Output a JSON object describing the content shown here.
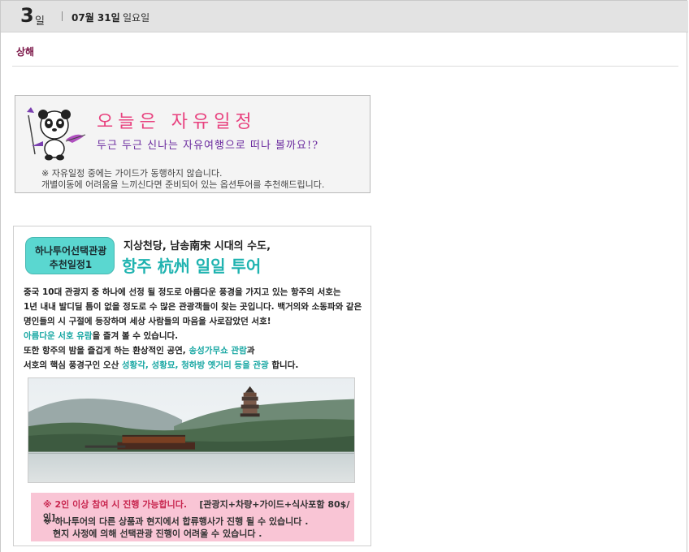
{
  "day": {
    "number": "3",
    "suffix": "일",
    "date": "07월 31일",
    "weekday": "일요일"
  },
  "city": "상해",
  "free_schedule": {
    "title": "오늘은 자유일정",
    "subtitle": "두근 두근 신나는 자유여행으로 떠나 볼까요!?",
    "note_line1": "※ 자유일정 중에는 가이드가 동행하지 않습니다.",
    "note_line2": "개별이동에 어려움을 느끼신다면 준비되어 있는 옵션투어를 추천해드립니다."
  },
  "tour": {
    "badge_line1": "하나투어선택관광",
    "badge_line2": "추천일정1",
    "subtitle": "지상천당, 남송南宋 시대의 수도,",
    "title": "항주 杭州 일일 투어",
    "desc": {
      "line1": "중국 10대 관광지 중 하나에 선정 될 정도로 아름다운 풍경을 가지고 있는 항주의 서호는",
      "line2": "1년 내내 발디딜 틈이 없을 정도로 수 많은 관광객들이 찾는 곳입니다. 백거의와 소동파와 같은",
      "line3": "명인들의 시 구절에 등장하며 세상 사람들의 마음을 사로잡았던 서호!",
      "line4_hl": "아름다운 서호 유람",
      "line4_rest": "을 즐겨 볼 수 있습니다.",
      "line5_pre": "또한 항주의 밤을 즐겁게 하는 환상적인 공연, ",
      "line5_hl": "송성가무쇼 관람",
      "line5_post": "과",
      "line6_pre": "서호의 핵심 풍경구인 오산 ",
      "line6_hl": "성황각, 성황묘, 청하방 옛거리 등을 관광",
      "line6_post": " 합니다."
    },
    "notice": {
      "line1": "※ 2인 이상 참여 시 진행 가능합니다.",
      "price": "[관광지+차량+가이드+식사포함 80$/인]",
      "line2": "※ 하나투어의 다른 상품과 현지에서 합류행사가 진행 될 수 있습니다 .",
      "line3": "현지 사정에 의해 선택관광 진행이 어려울 수 있습니다 ."
    }
  },
  "colors": {
    "header_bg": "#e3e3e3",
    "city": "#7a1446",
    "accent_teal": "#1fb3b0",
    "badge": "#5ad7d0",
    "pink_box": "#f9c5d5",
    "free_title": "#e8417e",
    "free_sub": "#6a2a9e"
  }
}
